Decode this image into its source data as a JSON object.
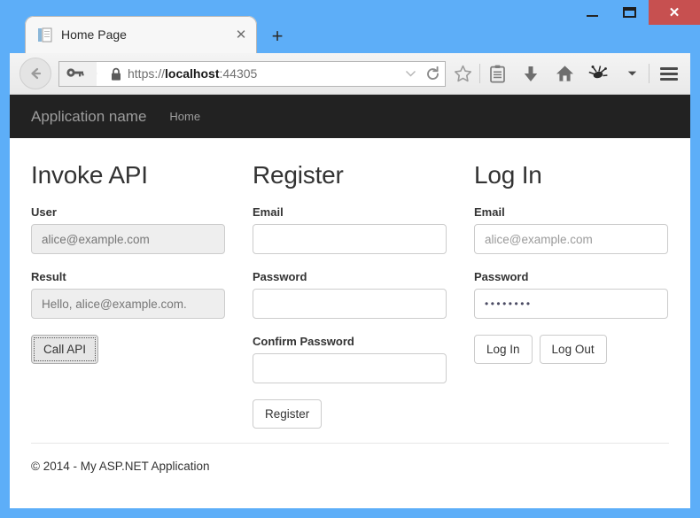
{
  "window": {
    "minimize_label": "Minimize",
    "maximize_label": "Maximize",
    "close_label": "✕",
    "frame_color": "#5daef8"
  },
  "browser": {
    "tab": {
      "title": "Home Page",
      "close_label": "✕",
      "favicon": "page-icon"
    },
    "new_tab_label": "+",
    "back_label": "←",
    "url": {
      "scheme": "https://",
      "host": "localhost",
      "port": ":44305",
      "full": "https://localhost:44305",
      "identity_icon": "key-icon",
      "lock_icon": "padlock-icon",
      "dropdown_label": "▾",
      "reload_label": "⟳"
    },
    "toolbar_icons": [
      {
        "name": "bookmark-star-icon",
        "glyph": "☆"
      },
      {
        "name": "reader-list-icon",
        "glyph": "▤"
      },
      {
        "name": "downloads-icon",
        "glyph": "⬇"
      },
      {
        "name": "home-icon",
        "glyph": "⌂"
      },
      {
        "name": "extension-icon",
        "glyph": "✹"
      },
      {
        "name": "overflow-chevron-icon",
        "glyph": "▾"
      }
    ],
    "menu_label": "☰"
  },
  "site": {
    "navbar": {
      "brand": "Application name",
      "links": [
        {
          "label": "Home"
        }
      ],
      "background": "#222222",
      "text_color": "#9d9d9d"
    },
    "columns": [
      {
        "heading": "Invoke API",
        "fields": [
          {
            "label": "User",
            "value": "alice@example.com",
            "readonly": true,
            "placeholder": ""
          },
          {
            "label": "Result",
            "value": "Hello, alice@example.com.",
            "readonly": true,
            "placeholder": ""
          }
        ],
        "buttons": [
          {
            "label": "Call API",
            "focused": true
          }
        ]
      },
      {
        "heading": "Register",
        "fields": [
          {
            "label": "Email",
            "value": "",
            "readonly": false,
            "placeholder": ""
          },
          {
            "label": "Password",
            "value": "",
            "readonly": false,
            "placeholder": ""
          },
          {
            "label": "Confirm Password",
            "value": "",
            "readonly": false,
            "placeholder": ""
          }
        ],
        "buttons": [
          {
            "label": "Register",
            "focused": false
          }
        ]
      },
      {
        "heading": "Log In",
        "fields": [
          {
            "label": "Email",
            "value": "alice@example.com",
            "readonly": false,
            "placeholder": "alice@example.com",
            "is_placeholder": true
          },
          {
            "label": "Password",
            "value": "••••••••",
            "readonly": false,
            "placeholder": "",
            "is_password": true
          }
        ],
        "buttons": [
          {
            "label": "Log In",
            "focused": false
          },
          {
            "label": "Log Out",
            "focused": false
          }
        ]
      }
    ],
    "footer": {
      "copyright": "© 2014 - My ASP.NET Application"
    }
  }
}
